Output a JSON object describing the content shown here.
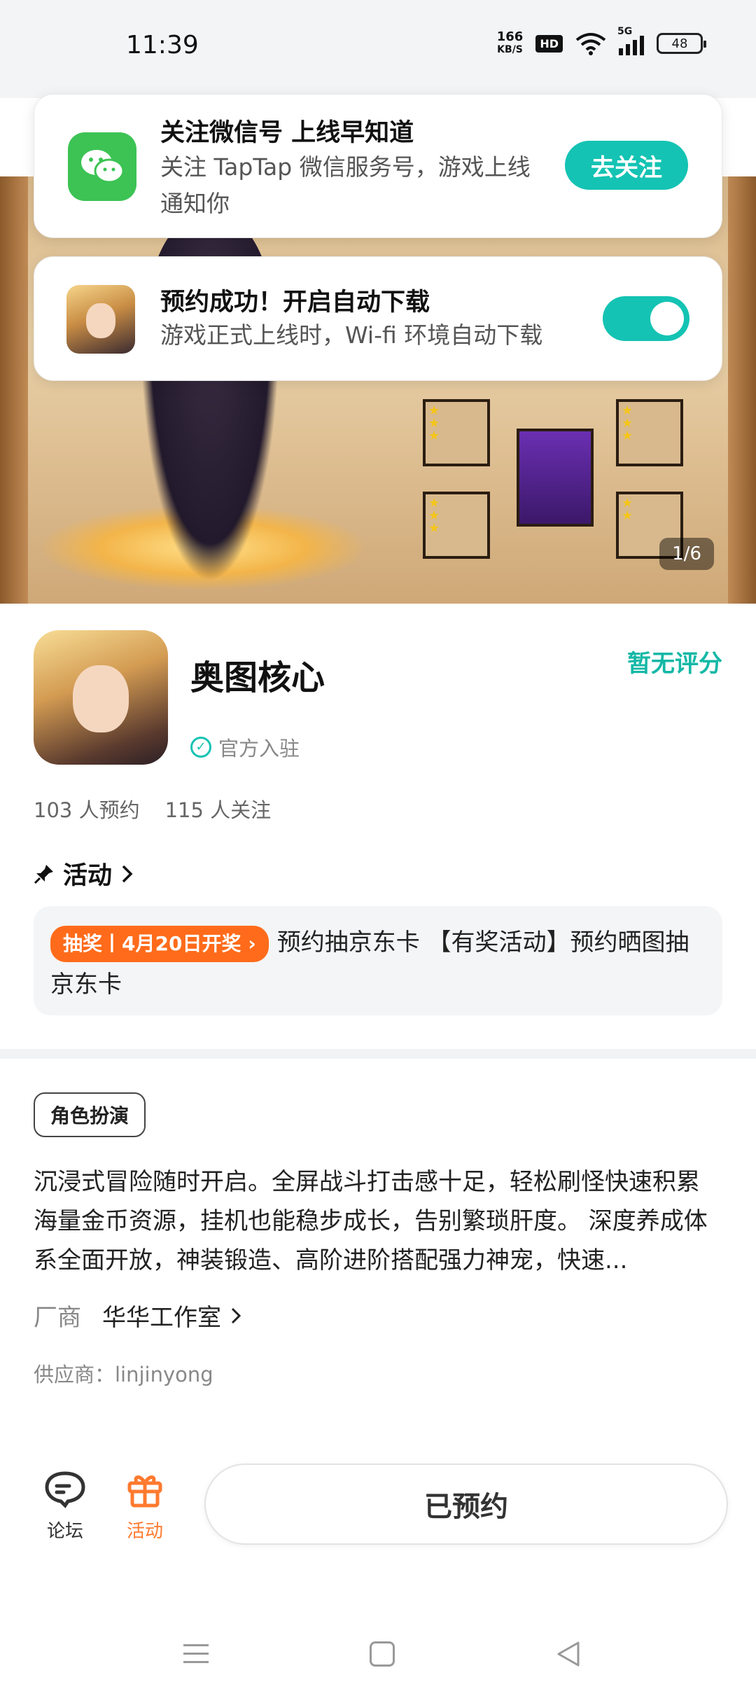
{
  "status_bar": {
    "time": "11:39",
    "net_speed_value": "166",
    "net_speed_unit": "KB/S",
    "hd": "HD",
    "network": "5G",
    "battery": "48"
  },
  "hero": {
    "page_indicator": "1/6"
  },
  "wechat_notice": {
    "title": "关注微信号 上线早知道",
    "text": "关注 TapTap 微信服务号，游戏上线通知你",
    "button": "去关注"
  },
  "download_notice": {
    "title": "预约成功！开启自动下载",
    "text": "游戏正式上线时，Wi-fi 环境自动下载",
    "toggle_on": true
  },
  "game": {
    "title": "奥图核心",
    "rating": "暂无评分",
    "official": "官方入驻",
    "reservations": "103 人预约",
    "followers": "115 人关注"
  },
  "activity": {
    "header": "活动",
    "tag": "抽奖丨4月20日开奖",
    "text": "预约抽京东卡 【有奖活动】预约晒图抽京东卡"
  },
  "description": {
    "genre": "角色扮演",
    "text": "沉浸式冒险随时开启。全屏战斗打击感十足，轻松刷怪快速积累海量金币资源，挂机也能稳步成长，告别繁琐肝度。 深度养成体系全面开放，神装锻造、高阶进阶搭配强力神宠，快速...",
    "vendor_label": "厂商",
    "vendor_name": "华华工作室",
    "supplier": "供应商：linjinyong"
  },
  "bottom_bar": {
    "forum": "论坛",
    "activity": "活动",
    "reserved_button": "已预约"
  },
  "colors": {
    "accent": "#14c3b3",
    "lottery": "#ff6b1a",
    "activity_tab": "#ff7a2f"
  }
}
